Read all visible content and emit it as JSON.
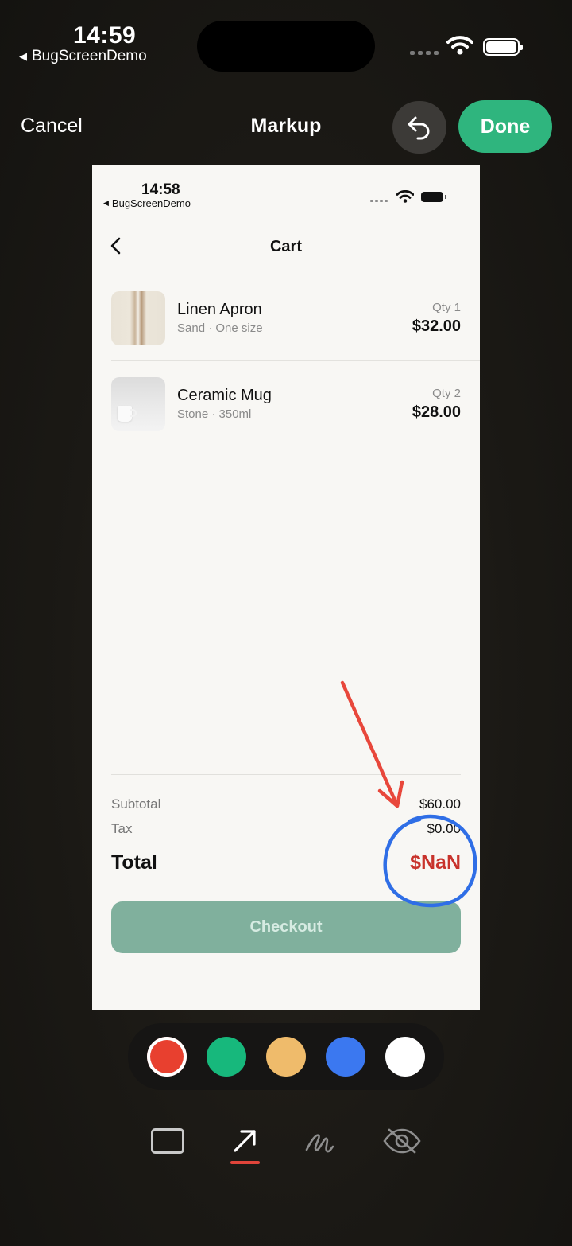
{
  "status_bar": {
    "time": "14:59",
    "back_app": "BugScreenDemo"
  },
  "toolbar": {
    "cancel_label": "Cancel",
    "title": "Markup",
    "undo_icon": "undo-icon",
    "done_label": "Done",
    "done_color": "#2fb57e"
  },
  "screenshot": {
    "status_bar": {
      "time": "14:58",
      "back_app": "BugScreenDemo"
    },
    "nav": {
      "title": "Cart",
      "back_icon": "chevron-left-icon"
    },
    "items": [
      {
        "name": "Linen Apron",
        "variant": "Sand · One size",
        "qty": "Qty 1",
        "price": "$32.00"
      },
      {
        "name": "Ceramic Mug",
        "variant": "Stone · 350ml",
        "qty": "Qty 2",
        "price": "$28.00"
      }
    ],
    "summary": {
      "subtotal_label": "Subtotal",
      "subtotal_value": "$60.00",
      "tax_label": "Tax",
      "tax_value": "$0.00",
      "total_label": "Total",
      "total_value": "$NaN",
      "total_color": "#c8332c"
    },
    "checkout_label": "Checkout",
    "checkout_color": "#80b09d"
  },
  "annotations": {
    "arrow_color": "#e8473b",
    "circle_color": "#2f6ee6"
  },
  "palette": {
    "colors": [
      "#e8402f",
      "#17b87c",
      "#efbb6b",
      "#3b78f0",
      "#ffffff"
    ],
    "selected_index": 0
  },
  "tools": {
    "items": [
      "rectangle-icon",
      "arrow-icon",
      "pen-icon",
      "redact-icon"
    ],
    "selected": "arrow-icon"
  }
}
